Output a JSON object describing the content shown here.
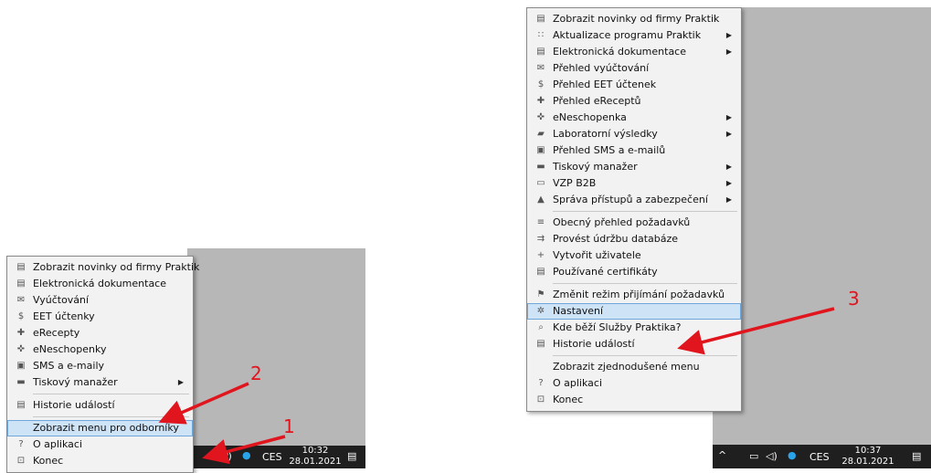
{
  "left": {
    "menu_items": [
      {
        "label": "Zobrazit novinky od firmy Praktik",
        "icon": "news-icon",
        "arrow": false,
        "selected": false,
        "sep_after": false
      },
      {
        "label": "Elektronická dokumentace",
        "icon": "document-icon",
        "arrow": false,
        "selected": false,
        "sep_after": false
      },
      {
        "label": "Vyúčtování",
        "icon": "envelope-icon",
        "arrow": false,
        "selected": false,
        "sep_after": false
      },
      {
        "label": "EET účtenky",
        "icon": "dollar-icon",
        "arrow": false,
        "selected": false,
        "sep_after": false
      },
      {
        "label": "eRecepty",
        "icon": "cross-icon",
        "arrow": false,
        "selected": false,
        "sep_after": false
      },
      {
        "label": "eNeschopenky",
        "icon": "cross-outline-icon",
        "arrow": false,
        "selected": false,
        "sep_after": false
      },
      {
        "label": "SMS a e-maily",
        "icon": "message-icon",
        "arrow": false,
        "selected": false,
        "sep_after": false
      },
      {
        "label": "Tiskový manažer",
        "icon": "printer-icon",
        "arrow": true,
        "selected": false,
        "sep_after": true
      },
      {
        "label": "Historie událostí",
        "icon": "history-icon",
        "arrow": false,
        "selected": false,
        "sep_after": true
      },
      {
        "label": "Zobrazit menu pro odborníky",
        "icon": "",
        "arrow": false,
        "selected": true,
        "sep_after": false
      },
      {
        "label": "O aplikaci",
        "icon": "question-icon",
        "arrow": false,
        "selected": false,
        "sep_after": false
      },
      {
        "label": "Konec",
        "icon": "exit-icon",
        "arrow": false,
        "selected": false,
        "sep_after": false
      }
    ],
    "taskbar": {
      "lang": "CES",
      "time": "10:32",
      "date": "28.01.2021"
    },
    "annotations": [
      "1",
      "2"
    ]
  },
  "right": {
    "menu_items": [
      {
        "label": "Zobrazit novinky od firmy Praktik",
        "icon": "news-icon",
        "arrow": false,
        "selected": false,
        "sep_after": false
      },
      {
        "label": "Aktualizace programu Praktik",
        "icon": "grid-icon",
        "arrow": true,
        "selected": false,
        "sep_after": false
      },
      {
        "label": "Elektronická dokumentace",
        "icon": "document-icon",
        "arrow": true,
        "selected": false,
        "sep_after": false
      },
      {
        "label": "Přehled vyúčtování",
        "icon": "envelope-icon",
        "arrow": false,
        "selected": false,
        "sep_after": false
      },
      {
        "label": "Přehled EET účtenek",
        "icon": "dollar-icon",
        "arrow": false,
        "selected": false,
        "sep_after": false
      },
      {
        "label": "Přehled eReceptů",
        "icon": "cross-icon",
        "arrow": false,
        "selected": false,
        "sep_after": false
      },
      {
        "label": "eNeschopenka",
        "icon": "cross-outline-icon",
        "arrow": true,
        "selected": false,
        "sep_after": false
      },
      {
        "label": "Laboratorní výsledky",
        "icon": "folder-icon",
        "arrow": true,
        "selected": false,
        "sep_after": false
      },
      {
        "label": "Přehled SMS a e-mailů",
        "icon": "message-icon",
        "arrow": false,
        "selected": false,
        "sep_after": false
      },
      {
        "label": "Tiskový manažer",
        "icon": "printer-icon",
        "arrow": true,
        "selected": false,
        "sep_after": false
      },
      {
        "label": "VZP B2B",
        "icon": "window-icon",
        "arrow": true,
        "selected": false,
        "sep_after": false
      },
      {
        "label": "Správa přístupů a zabezpečení",
        "icon": "lock-icon",
        "arrow": true,
        "selected": false,
        "sep_after": true
      },
      {
        "label": "Obecný přehled požadavků",
        "icon": "list-icon",
        "arrow": false,
        "selected": false,
        "sep_after": false
      },
      {
        "label": "Provést údržbu databáze",
        "icon": "maintenance-icon",
        "arrow": false,
        "selected": false,
        "sep_after": false
      },
      {
        "label": "Vytvořit uživatele",
        "icon": "plus-icon",
        "arrow": false,
        "selected": false,
        "sep_after": false
      },
      {
        "label": "Používané certifikáty",
        "icon": "certificate-icon",
        "arrow": false,
        "selected": false,
        "sep_after": true
      },
      {
        "label": "Změnit režim přijímání požadavků",
        "icon": "flag-icon",
        "arrow": false,
        "selected": false,
        "sep_after": false
      },
      {
        "label": "Nastavení",
        "icon": "gear-icon",
        "arrow": false,
        "selected": true,
        "sep_after": false
      },
      {
        "label": "Kde běží Služby Praktika?",
        "icon": "search-icon",
        "arrow": false,
        "selected": false,
        "sep_after": false
      },
      {
        "label": "Historie událostí",
        "icon": "history-icon",
        "arrow": false,
        "selected": false,
        "sep_after": true
      },
      {
        "label": "Zobrazit zjednodušené menu",
        "icon": "",
        "arrow": false,
        "selected": false,
        "sep_after": false
      },
      {
        "label": "O aplikaci",
        "icon": "question-icon",
        "arrow": false,
        "selected": false,
        "sep_after": false
      },
      {
        "label": "Konec",
        "icon": "exit-icon",
        "arrow": false,
        "selected": false,
        "sep_after": false
      }
    ],
    "taskbar": {
      "lang": "CES",
      "time": "10:37",
      "date": "28.01.2021"
    },
    "annotations": [
      "3"
    ]
  },
  "icons": {
    "news-icon": "▤",
    "grid-icon": "∷",
    "document-icon": "▤",
    "envelope-icon": "✉",
    "dollar-icon": "$",
    "cross-icon": "✚",
    "cross-outline-icon": "✜",
    "folder-icon": "▰",
    "message-icon": "▣",
    "printer-icon": "▬",
    "window-icon": "▭",
    "lock-icon": "▲",
    "list-icon": "≡",
    "maintenance-icon": "⇉",
    "plus-icon": "+",
    "certificate-icon": "▤",
    "flag-icon": "⚑",
    "gear-icon": "✲",
    "search-icon": "⌕",
    "history-icon": "▤",
    "question-icon": "?",
    "exit-icon": "⊡"
  },
  "colors": {
    "selection": "#cfe3f7",
    "arrow": "#e0151d",
    "desktop": "#b7b7b7",
    "taskbar": "#1f1f1f"
  }
}
